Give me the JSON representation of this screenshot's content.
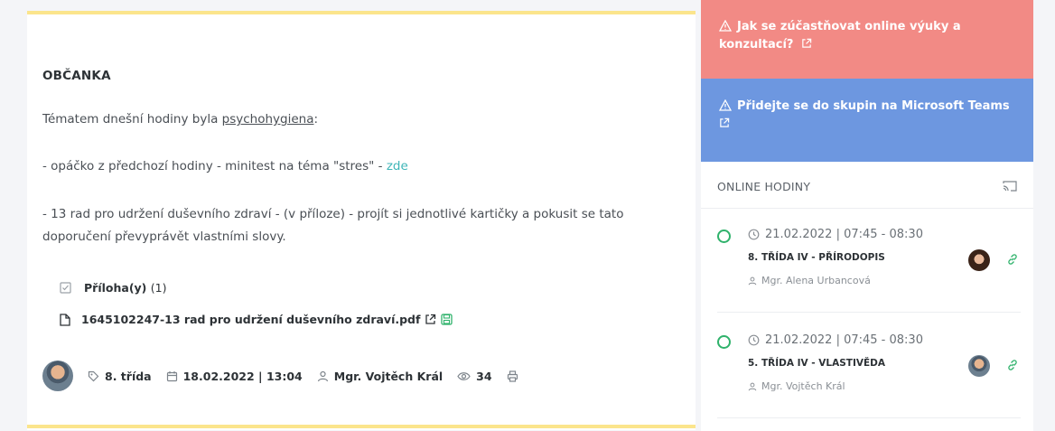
{
  "post": {
    "title": "OBČANKA",
    "intro_prefix": "Tématem dnešní hodiny byla ",
    "intro_link": "psychohygiena",
    "intro_suffix": ":",
    "line2_text": "- opáčko z předchozí hodiny - minitest na téma \"stres\" - ",
    "line2_link": "zde",
    "line3a": "- 13 rad pro udržení duševního zdraví - (v příloze) - projít si jednotlivé kartičky a pokusit se tato",
    "line3b": "doporučení převyprávět vlastními slovy.",
    "attachments_label": "Příloha(y)",
    "attachments_count": "(1)",
    "attachment_file": "1645102247-13 rad pro udržení duševního zdraví.pdf",
    "class_tag": "8. třída",
    "date": "18.02.2022 | 13:04",
    "author": "Mgr. Vojtěch Král",
    "views": "34"
  },
  "sidebar": {
    "alert_red": "Jak se zúčastňovat online výuky a konzultací?",
    "alert_blue": "Přidejte se do skupin na Microsoft Teams",
    "online_title": "ONLINE HODINY",
    "lessons": [
      {
        "time": "21.02.2022 | 07:45 - 08:30",
        "subject": "8. TŘÍDA IV - PŘÍRODOPIS",
        "teacher": "Mgr. Alena Urbancová"
      },
      {
        "time": "21.02.2022 | 07:45 - 08:30",
        "subject": "5. TŘÍDA IV - VLASTIVĚDA",
        "teacher": "Mgr. Vojtěch Král"
      }
    ]
  },
  "colors": {
    "accent_yellow": "#fbe58c",
    "alert_red": "#f28a85",
    "alert_blue": "#6d97e0",
    "link_teal": "#3fb6b8",
    "status_green": "#2fb26b"
  },
  "icons": [
    "checkbox-icon",
    "file-icon",
    "external-link-icon",
    "save-icon",
    "tag-icon",
    "calendar-icon",
    "user-icon",
    "eye-icon",
    "print-icon",
    "warning-icon",
    "cast-icon",
    "clock-icon",
    "link-icon"
  ]
}
